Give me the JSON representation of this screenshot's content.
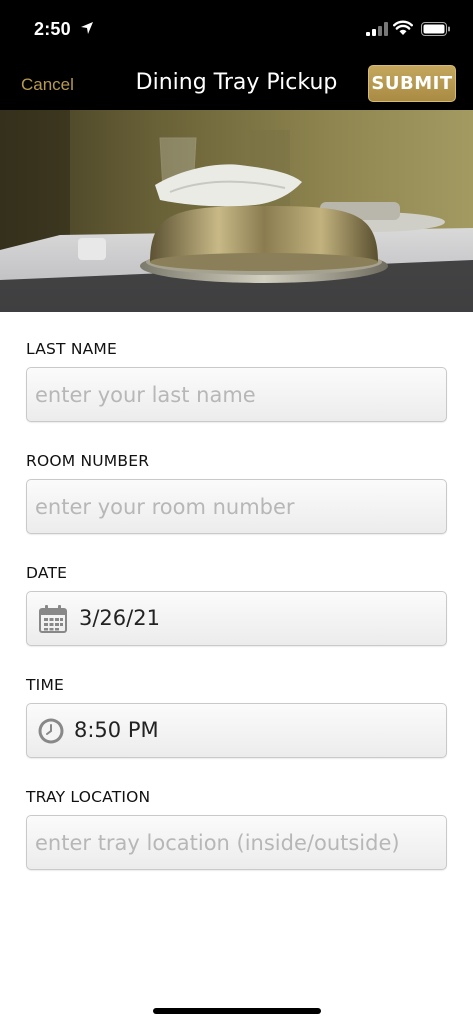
{
  "status_bar": {
    "time": "2:50"
  },
  "nav": {
    "cancel_label": "Cancel",
    "title": "Dining Tray Pickup",
    "submit_label": "SUBMIT"
  },
  "colors": {
    "accent_gold": "#b69a52",
    "nav_background": "#000000"
  },
  "form": {
    "last_name": {
      "label": "LAST NAME",
      "placeholder": "enter your last name"
    },
    "room_number": {
      "label": "ROOM NUMBER",
      "placeholder": "enter your room number"
    },
    "date": {
      "label": "DATE",
      "value": "3/26/21",
      "icon": "calendar-icon"
    },
    "time": {
      "label": "TIME",
      "value": "8:50 PM",
      "icon": "clock-icon"
    },
    "tray_location": {
      "label": "TRAY LOCATION",
      "placeholder": "enter tray location (inside/outside)"
    }
  }
}
